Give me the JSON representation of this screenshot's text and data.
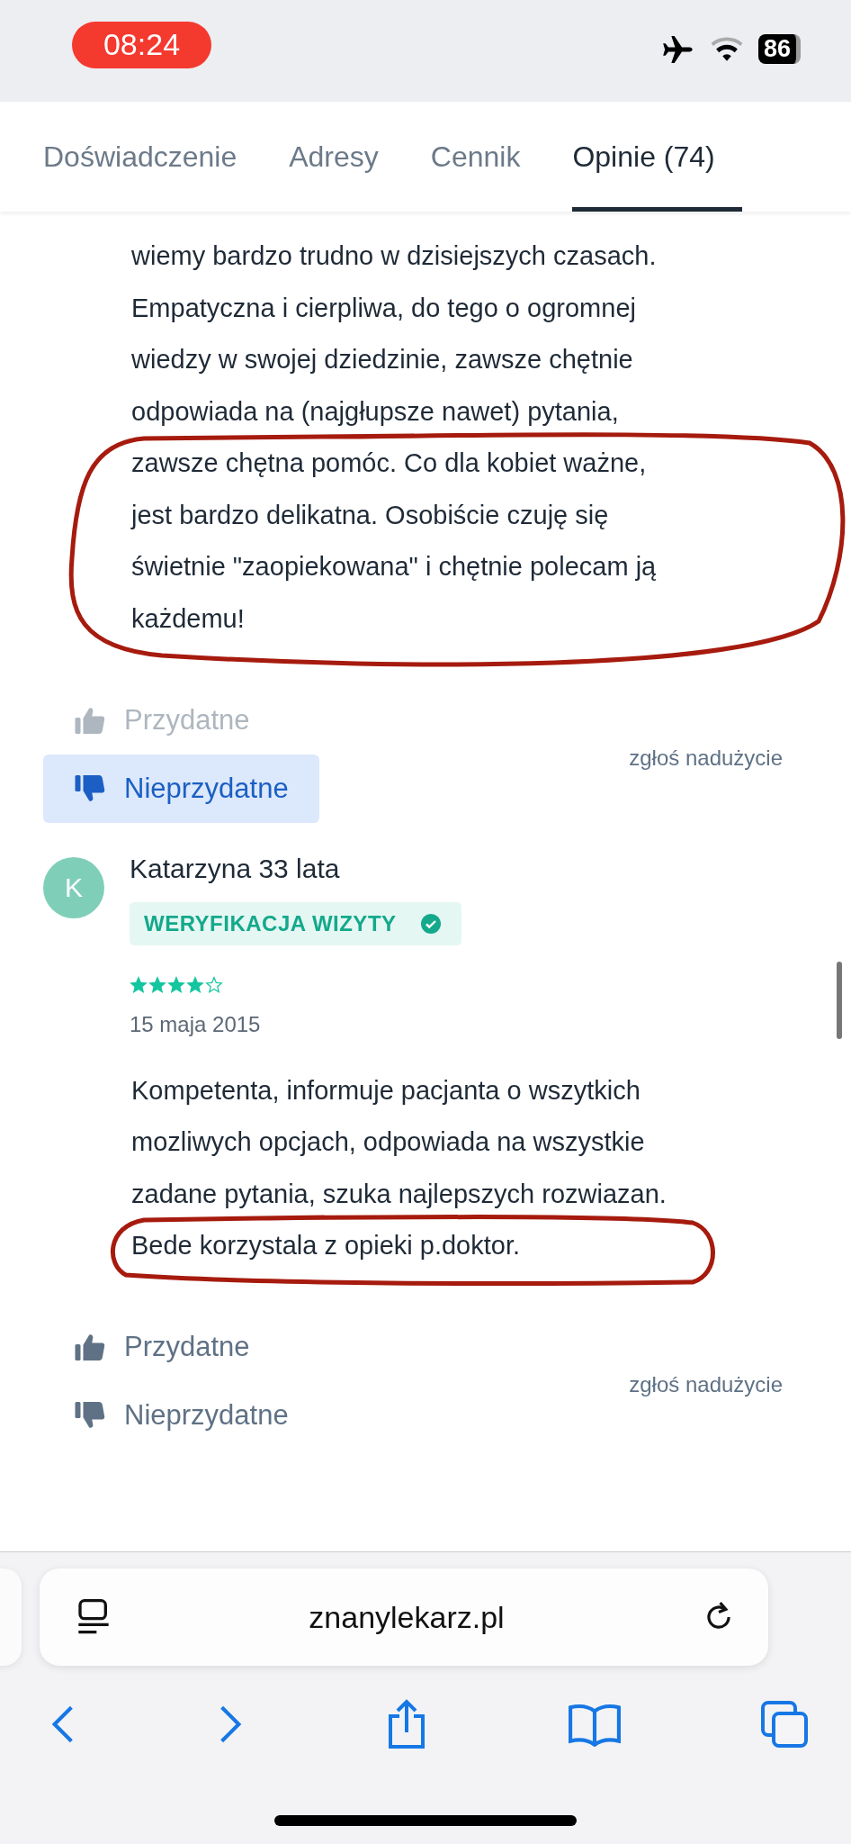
{
  "status_bar": {
    "time": "08:24",
    "battery": "86"
  },
  "tabs": [
    {
      "label": "Doświadczenie",
      "selected": false
    },
    {
      "label": "Adresy",
      "selected": false
    },
    {
      "label": "Cennik",
      "selected": false
    },
    {
      "label": "Opinie (74)",
      "selected": true
    }
  ],
  "reviews": [
    {
      "text_lines": [
        "wiemy bardzo trudno w dzisiejszych czasach.",
        "Empatyczna i cierpliwa, do tego o ogromnej",
        "wiedzy w swojej dziedzinie, zawsze chętnie",
        "odpowiada na (najgłupsze nawet) pytania,",
        "zawsze chętna pomóc. Co dla kobiet ważne,",
        "jest bardzo delikatna. Osobiście czuję się",
        "świetnie \"zaopiekowana\" i chętnie polecam ją",
        "każdemu!"
      ],
      "votes": [
        {
          "kind": "up",
          "label": "Przydatne",
          "selected": false
        },
        {
          "kind": "down",
          "label": "Nieprzydatne",
          "selected": true
        }
      ],
      "report": "zgłoś nadużycie"
    },
    {
      "avatar": "K",
      "author": "Katarzyna 33 lata",
      "badge": "WERYFIKACJA WIZYTY",
      "stars": 4,
      "date": "15 maja 2015",
      "text_lines": [
        "Kompetenta, informuje pacjanta o wszytkich",
        "mozliwych opcjach, odpowiada na wszystkie",
        "zadane pytania, szuka najlepszych rozwiazan.",
        "Bede korzystala z opieki p.doktor."
      ],
      "votes": [
        {
          "kind": "up",
          "label": "Przydatne",
          "selected": false
        },
        {
          "kind": "down",
          "label": "Nieprzydatne",
          "selected": false
        }
      ],
      "report": "zgłoś nadużycie"
    }
  ],
  "browser": {
    "url": "znanylekarz.pl"
  }
}
